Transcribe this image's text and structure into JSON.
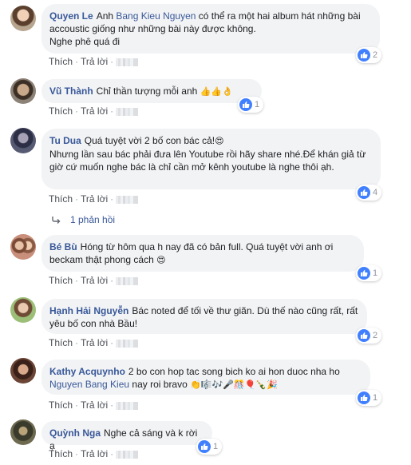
{
  "actions": {
    "like": "Thích",
    "reply": "Trả lời",
    "separator": "·"
  },
  "comments": [
    {
      "author": "Quyen Le",
      "text_before": "Anh ",
      "mention": "Bang Kieu Nguyen",
      "text_after": " có thể ra một hai album hát những bài accoustic giống như những bài này được không.",
      "line2": "Nghe phê quá đi",
      "likes": "2",
      "avatar_color": "#8a7d6d"
    },
    {
      "author": "Vũ Thành",
      "text": "Chỉ thần tượng mỗi anh",
      "emojis": "👍👍👌",
      "likes": "1",
      "avatar_color": "#6b5a4a"
    },
    {
      "author": "Tu Dua",
      "text": "Quá tuyệt vời 2 bố con bác cả!",
      "emoji": "😍",
      "line2": "Nhưng lần sau bác phải đưa lên Youtube rồi hãy share nhé.Để khán giả từ giờ cứ muốn nghe bác là chỉ cần mở kênh youtube là nghe thôi ạh.",
      "likes": "4",
      "avatar_color": "#3c3f52"
    },
    {
      "author": "Bé Bù",
      "text": "Hóng từ hôm qua h nay đã có bản full. Quá tuyệt vời anh ơi",
      "line2": "beckam thật phong cách",
      "emoji": "😍",
      "likes": "1",
      "avatar_color": "#b98a74"
    },
    {
      "author": "Hạnh Hải Nguyễn",
      "text": "Bác noted để tối về thư giãn. Dù thế nào cũng rất, rất yêu bố con nhà Bầu!",
      "likes": "2",
      "avatar_color": "#8fae6e"
    },
    {
      "author": "Kathy Acquynho",
      "text": "2 bo con hop tac song bich ko ai hon duoc nha ho",
      "mention": "Nguyen Bang Kieu",
      "text_after": " nay roi bravo",
      "emojis": "👏🎼🎶🎤🎊🎈🍾🎉",
      "likes": "1",
      "avatar_color": "#5a3a2e"
    },
    {
      "author": "Quỳnh Nga",
      "text": "Nghe cả sáng và k rời ạ",
      "likes": "1",
      "avatar_color": "#4a4a3a"
    }
  ],
  "reply_link": {
    "icon": "reply-arrow-icon",
    "label": "1 phản hồi"
  },
  "colors": {
    "link": "#385898",
    "bubble": "#f2f3f5",
    "like": "#4080ff",
    "meta": "#90949c"
  }
}
